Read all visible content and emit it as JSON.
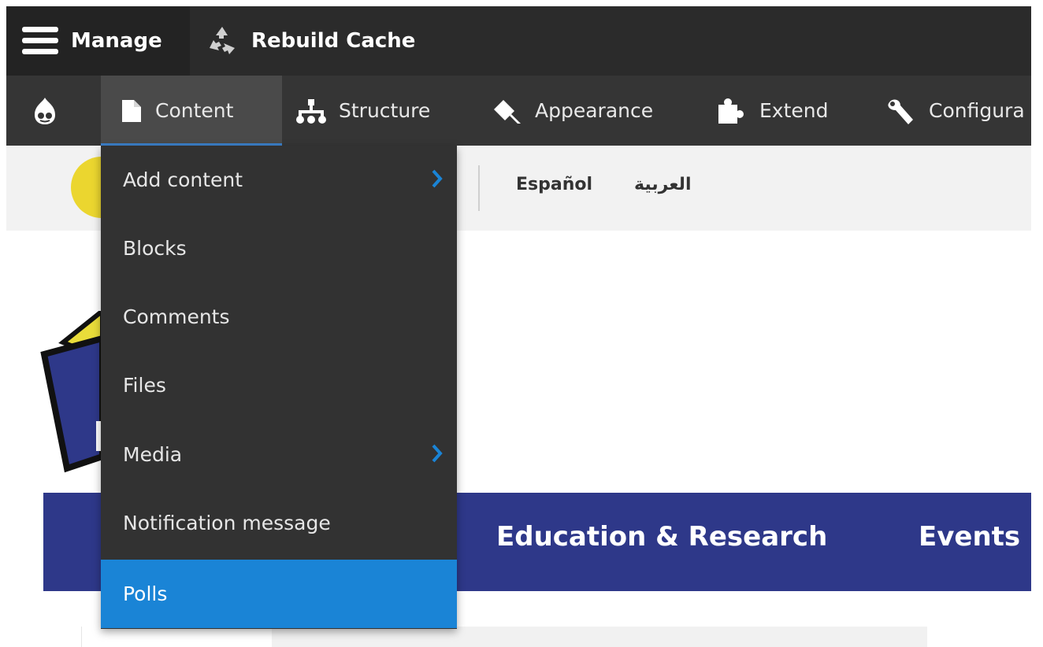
{
  "toolbar": {
    "manage_label": "Manage",
    "rebuild_label": "Rebuild Cache"
  },
  "tray": {
    "items": [
      {
        "label": "Content",
        "icon": "page-icon"
      },
      {
        "label": "Structure",
        "icon": "sitemap-icon"
      },
      {
        "label": "Appearance",
        "icon": "paint-icon"
      },
      {
        "label": "Extend",
        "icon": "puzzle-icon"
      },
      {
        "label": "Configura",
        "icon": "wrench-icon"
      }
    ]
  },
  "languages": {
    "spanish": "Español",
    "arabic": "العربية"
  },
  "dropdown": {
    "items": [
      {
        "label": "Add content",
        "has_submenu": true
      },
      {
        "label": "Blocks",
        "has_submenu": false
      },
      {
        "label": "Comments",
        "has_submenu": false
      },
      {
        "label": "Files",
        "has_submenu": false
      },
      {
        "label": "Media",
        "has_submenu": true
      },
      {
        "label": "Notification message",
        "has_submenu": false
      },
      {
        "label": "Polls",
        "has_submenu": false
      }
    ]
  },
  "site_nav": {
    "items": [
      "Education & Research",
      "Events"
    ]
  },
  "colors": {
    "toolbar_bg": "#232323",
    "tray_bg": "#353535",
    "highlight": "#1a84d6",
    "site_nav_bg": "#2e3889",
    "accent_yellow": "#ebd62f"
  }
}
